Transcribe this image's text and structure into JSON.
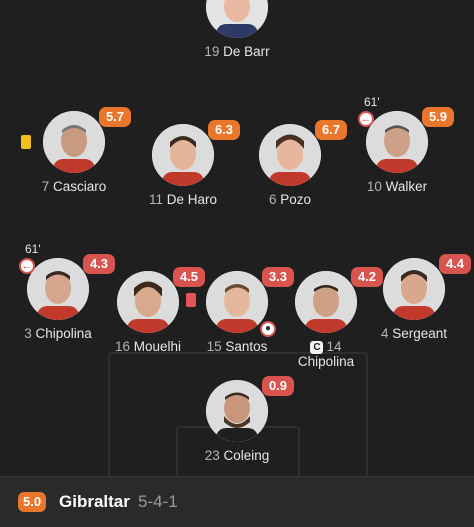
{
  "colors": {
    "rating_orange": "#e8762b",
    "rating_red": "#d9534f",
    "yellow_card": "#f2c21b"
  },
  "players": [
    {
      "id": "debarr",
      "number": "19",
      "name": "De Barr",
      "rating": null,
      "icon": "player-photo"
    },
    {
      "id": "casciaro",
      "number": "7",
      "name": "Casciaro",
      "rating": "5.7",
      "card": "yellow-card-icon"
    },
    {
      "id": "deharo",
      "number": "11",
      "name": "De Haro",
      "rating": "6.3"
    },
    {
      "id": "pozo",
      "number": "6",
      "name": "Pozo",
      "rating": "6.7"
    },
    {
      "id": "walker",
      "number": "10",
      "name": "Walker",
      "rating": "5.9",
      "sub_time": "61'"
    },
    {
      "id": "chipolina3",
      "number": "3",
      "name": "Chipolina",
      "rating": "4.3",
      "sub_time": "61'"
    },
    {
      "id": "mouelhi",
      "number": "16",
      "name": "Mouelhi",
      "rating": "4.5"
    },
    {
      "id": "santos",
      "number": "15",
      "name": "Santos",
      "rating": "3.3",
      "card": "red-card-icon"
    },
    {
      "id": "chipolina14",
      "number": "14",
      "name": "Chipolina",
      "rating": "4.2",
      "captain_label": "C"
    },
    {
      "id": "sergeant",
      "number": "4",
      "name": "Sergeant",
      "rating": "4.4"
    },
    {
      "id": "coleing",
      "number": "23",
      "name": "Coleing",
      "rating": "0.9"
    }
  ],
  "footer": {
    "rating": "5.0",
    "team": "Gibraltar",
    "formation": "5-4-1"
  }
}
